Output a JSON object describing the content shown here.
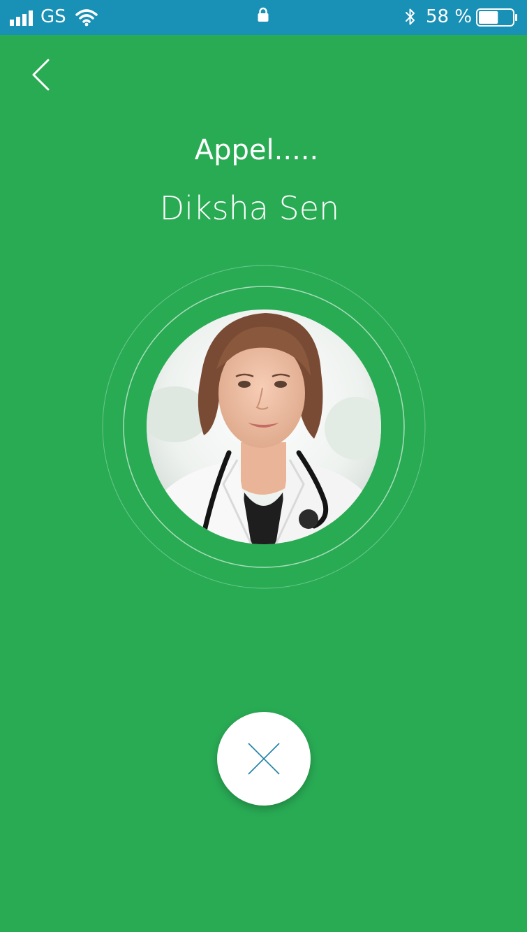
{
  "status_bar": {
    "carrier": "GS",
    "battery_percent": "58 %",
    "battery_level": 0.58,
    "icons": [
      "signal-icon",
      "wifi-icon",
      "lock-icon",
      "bluetooth-icon",
      "battery-icon"
    ]
  },
  "header": {
    "back_icon": "chevron-left-icon"
  },
  "call": {
    "status": "Appel.....",
    "contact_name": "Diksha Sen"
  },
  "actions": {
    "end_call_icon": "close-icon"
  },
  "colors": {
    "background": "#29ab54",
    "status_bar": "#1990b5",
    "end_call_glyph": "#1a7fa8",
    "text": "#ffffff"
  }
}
